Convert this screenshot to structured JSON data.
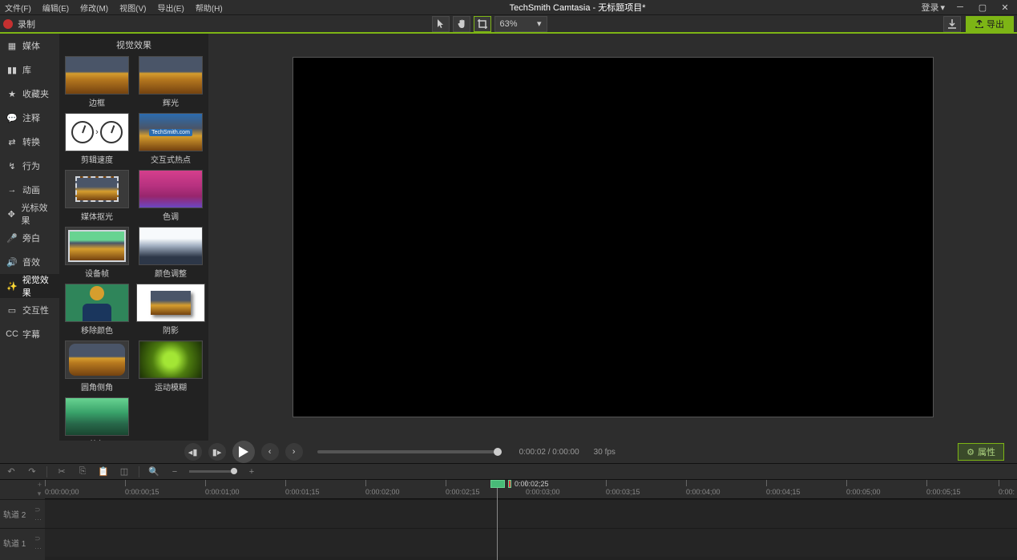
{
  "menu": {
    "file": "文件(F)",
    "edit": "编辑(E)",
    "modify": "修改(M)",
    "view": "视图(V)",
    "share": "导出(E)",
    "help": "帮助(H)"
  },
  "app_title": "TechSmith Camtasia - 无标题项目*",
  "login_label": "登录",
  "record_label": "录制",
  "zoom": "63%",
  "export_label": "导出",
  "panel_title": "视觉效果",
  "sidebar": {
    "items": [
      {
        "label": "媒体",
        "icon": "media-icon"
      },
      {
        "label": "库",
        "icon": "library-icon"
      },
      {
        "label": "收藏夹",
        "icon": "favorites-icon"
      },
      {
        "label": "注释",
        "icon": "annotation-icon"
      },
      {
        "label": "转换",
        "icon": "transition-icon"
      },
      {
        "label": "行为",
        "icon": "behavior-icon"
      },
      {
        "label": "动画",
        "icon": "animation-icon"
      },
      {
        "label": "光标效果",
        "icon": "cursor-icon"
      },
      {
        "label": "旁白",
        "icon": "narration-icon"
      },
      {
        "label": "音效",
        "icon": "audio-icon"
      },
      {
        "label": "视觉效果",
        "icon": "visual-icon"
      },
      {
        "label": "交互性",
        "icon": "interactivity-icon"
      },
      {
        "label": "字幕",
        "icon": "cc-icon"
      }
    ]
  },
  "effects": [
    {
      "label": "边框"
    },
    {
      "label": "辉光"
    },
    {
      "label": "剪辑速度"
    },
    {
      "label": "交互式热点"
    },
    {
      "label": "媒体抠光"
    },
    {
      "label": "色调"
    },
    {
      "label": "设备帧"
    },
    {
      "label": "颜色调整"
    },
    {
      "label": "移除颜色"
    },
    {
      "label": "阴影"
    },
    {
      "label": "圆角侧角"
    },
    {
      "label": "运动模糊"
    },
    {
      "label": "着色"
    }
  ],
  "hotspot_text": "TechSmith.com",
  "playback": {
    "time": "0:00:02 / 0:00:00",
    "fps": "30 fps",
    "props": "属性"
  },
  "playhead_time": "0:00:02;25",
  "ruler": [
    "0:00:00;00",
    "0:00:00;15",
    "0:00:01;00",
    "0:00:01;15",
    "0:00:02;00",
    "0:00:02;15",
    "0:00:03;00",
    "0:00:03;15",
    "0:00:04;00",
    "0:00:04;15",
    "0:00:05;00",
    "0:00:05;15",
    "0:00:"
  ],
  "tracks": [
    "轨道 2",
    "轨道 1"
  ]
}
